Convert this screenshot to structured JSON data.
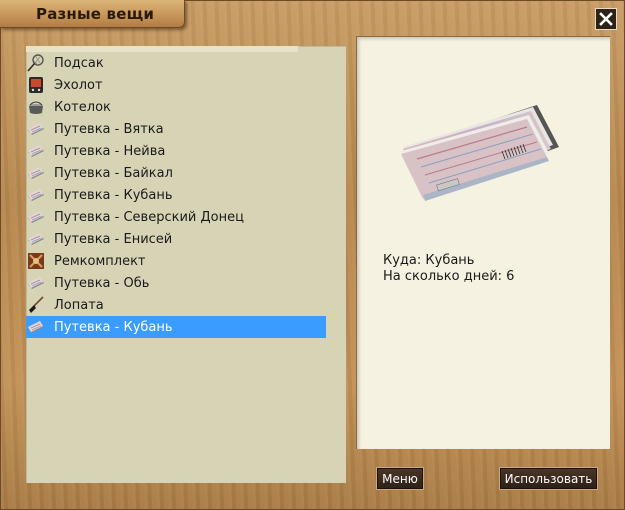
{
  "window": {
    "title": "Разные вещи",
    "close_label": "×"
  },
  "items": [
    {
      "label": "Подсак",
      "icon": "landing-net-icon"
    },
    {
      "label": "Эхолот",
      "icon": "echo-sounder-icon"
    },
    {
      "label": "Котелок",
      "icon": "pot-icon"
    },
    {
      "label": "Путевка - Вятка",
      "icon": "ticket-icon"
    },
    {
      "label": "Путевка - Нейва",
      "icon": "ticket-icon"
    },
    {
      "label": "Путевка - Байкал",
      "icon": "ticket-icon"
    },
    {
      "label": "Путевка - Кубань",
      "icon": "ticket-icon"
    },
    {
      "label": "Путевка - Северский Донец",
      "icon": "ticket-icon"
    },
    {
      "label": "Путевка - Енисей",
      "icon": "ticket-icon"
    },
    {
      "label": "Ремкомплект",
      "icon": "repair-kit-icon"
    },
    {
      "label": "Путевка - Обь",
      "icon": "ticket-icon"
    },
    {
      "label": "Лопата",
      "icon": "shovel-icon"
    },
    {
      "label": "Путевка - Кубань",
      "icon": "ticket-icon",
      "selected": true
    }
  ],
  "details": {
    "image": "ticket-stack-icon",
    "destination_line": "Куда: Кубань",
    "days_line": "На сколько дней: 6"
  },
  "buttons": {
    "menu": "Меню",
    "use": "Использовать"
  },
  "colors": {
    "selection": "#3b9cff",
    "list_bg": "#d7d4b6",
    "detail_bg": "#f5f2e2",
    "wood": "#c29257"
  }
}
